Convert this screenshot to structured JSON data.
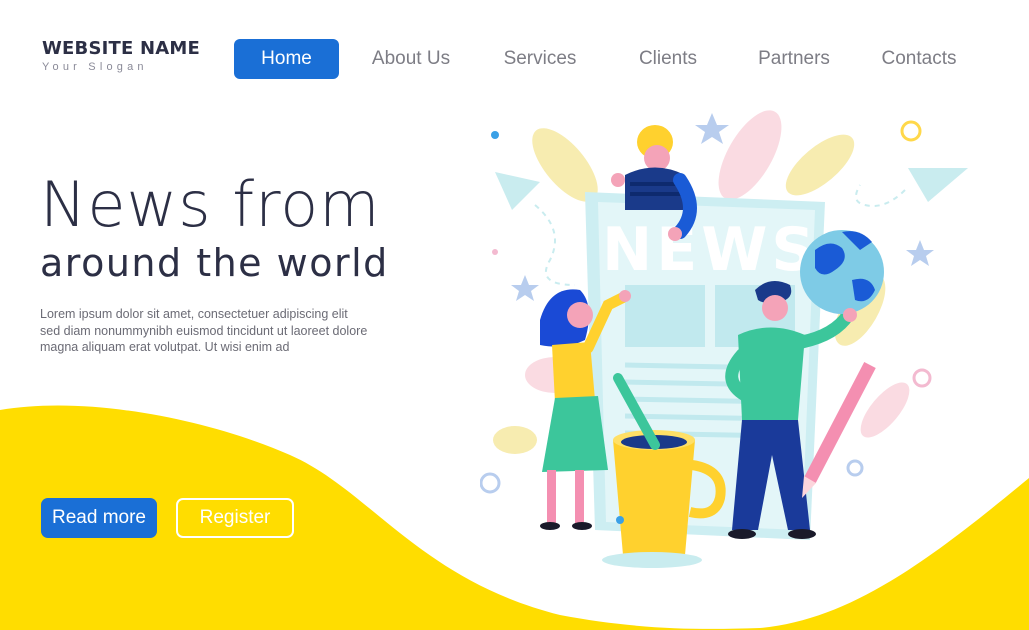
{
  "brand": {
    "name": "WEBSITE NAME",
    "slogan": "Your Slogan"
  },
  "nav": {
    "items": [
      {
        "label": "Home",
        "active": true
      },
      {
        "label": "About Us",
        "active": false
      },
      {
        "label": "Services",
        "active": false
      },
      {
        "label": "Clients",
        "active": false
      },
      {
        "label": "Partners",
        "active": false
      },
      {
        "label": "Contacts",
        "active": false
      }
    ]
  },
  "hero": {
    "title_line1": "News from",
    "title_line2": "around the world",
    "description": "Lorem ipsum dolor sit amet, consectetuer adipiscing elit sed diam nonummynibh euismod tincidunt ut laoreet dolore magna aliquam erat volutpat. Ut wisi enim ad"
  },
  "buttons": {
    "read_more": "Read more",
    "register": "Register"
  },
  "illustration": {
    "newspaper_headline": "NEWS"
  },
  "colors": {
    "accent": "#1a6fd6",
    "wave": "#ffdd00",
    "text": "#2c2f45"
  }
}
